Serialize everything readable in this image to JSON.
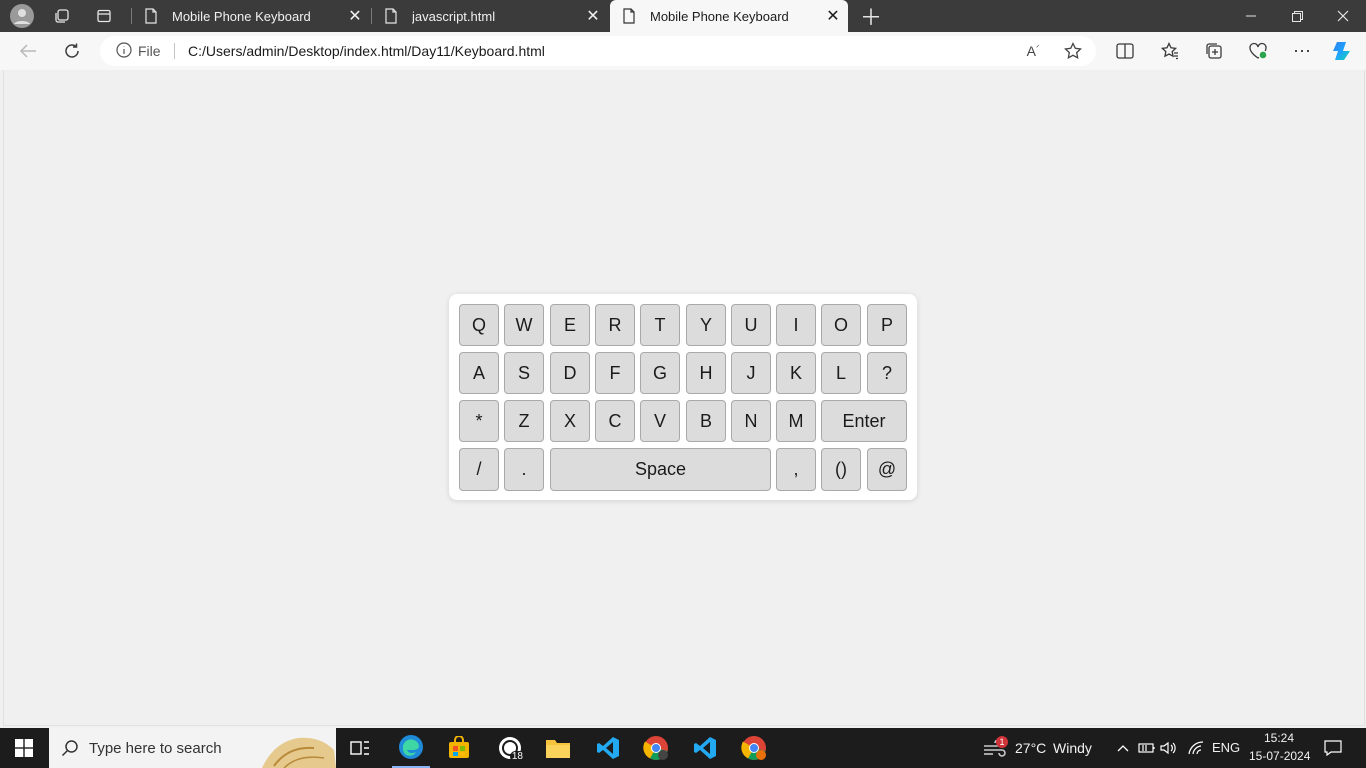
{
  "browser": {
    "tabs": [
      {
        "title": "Mobile Phone Keyboard",
        "active": false
      },
      {
        "title": "javascript.html",
        "active": false
      },
      {
        "title": "Mobile Phone Keyboard",
        "active": true
      }
    ],
    "address": {
      "scheme_label": "File",
      "url": "C:/Users/admin/Desktop/index.html/Day11/Keyboard.html"
    }
  },
  "keyboard": {
    "row1": [
      "Q",
      "W",
      "E",
      "R",
      "T",
      "Y",
      "U",
      "I",
      "O",
      "P"
    ],
    "row2": [
      "A",
      "S",
      "D",
      "F",
      "G",
      "H",
      "J",
      "K",
      "L",
      "?"
    ],
    "row3": [
      "*",
      "Z",
      "X",
      "C",
      "V",
      "B",
      "N",
      "M",
      "Enter"
    ],
    "row4": [
      "/",
      ".",
      "Space",
      ",",
      "()",
      "@"
    ]
  },
  "taskbar": {
    "search_placeholder": "Type here to search",
    "whatsapp_badge": "18",
    "weather": {
      "badge": "1",
      "temp": "27°C",
      "condition": "Windy"
    },
    "language": "ENG",
    "time": "15:24",
    "date": "15-07-2024"
  },
  "colors": {
    "titlebar": "#3b3b3b",
    "toolbar": "#f7f7f7",
    "page_bg": "#f0f0f0",
    "key_bg": "#dcdcdc",
    "key_border": "#a9a9a9",
    "taskbar": "#1c1c1c"
  }
}
